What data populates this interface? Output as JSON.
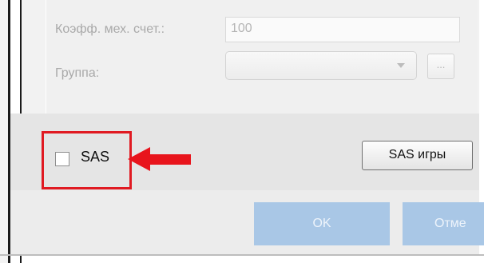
{
  "form": {
    "coefficient_label": "Коэфф. мех. счет.:",
    "coefficient_value": "100",
    "group_label": "Группа:",
    "group_value": "",
    "browse_button": "..."
  },
  "sas": {
    "checkbox_label": "SAS",
    "checked": false,
    "games_button": "SAS игры"
  },
  "dialog": {
    "ok_button": "OK",
    "cancel_button": "Отме"
  },
  "colors": {
    "highlight": "#e01a22",
    "arrow": "#e8141c",
    "primary_button": "#a9c7e6"
  },
  "annotation": {
    "arrow_direction": "left"
  }
}
